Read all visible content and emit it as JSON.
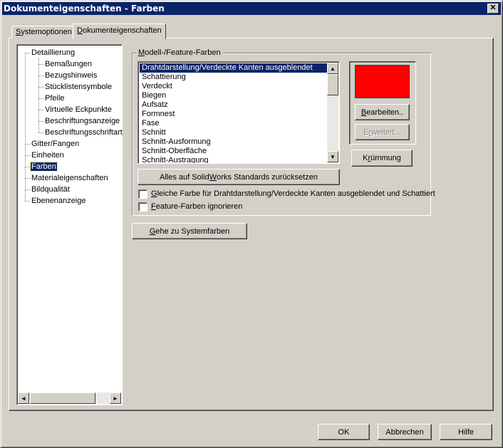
{
  "window": {
    "title": "Dokumenteigenschaften - Farben",
    "close": "✕"
  },
  "tabs": [
    {
      "pre": "",
      "key": "S",
      "post": "ystemoptionen"
    },
    {
      "pre": "",
      "key": "D",
      "post": "okumenteigenschaften"
    }
  ],
  "tree": {
    "items": [
      "Detaillierung",
      "Bemaßungen",
      "Bezugshinweis",
      "Stücklistensymbole",
      "Pfeile",
      "Virtuelle Eckpunkte",
      "Beschriftungsanzeige",
      "Beschriftungsschriftart",
      "Gitter/Fangen",
      "Einheiten",
      "Farben",
      "Materialeigenschaften",
      "Bildqualität",
      "Ebenenanzeige"
    ],
    "selected": "Farben",
    "scroll_left": "◄",
    "scroll_right": "►"
  },
  "group": {
    "label": {
      "pre": "",
      "key": "M",
      "post": "odell-/Feature-Farben"
    },
    "list": [
      "Drahtdarstellung/Verdeckte Kanten ausgeblendet",
      "Schattierung",
      "Verdeckt",
      "Biegen",
      "Aufsatz",
      "Formnest",
      "Fase",
      "Schnitt",
      "Schnitt-Ausformung",
      "Schnitt-Oberfläche",
      "Schnitt-Austragung"
    ],
    "scroll_up": "▲",
    "scroll_down": "▼",
    "swatch_color": "#ff0000",
    "edit": {
      "pre": "",
      "key": "B",
      "post": "earbeiten.."
    },
    "advanced": {
      "pre": "E",
      "key": "r",
      "post": "weitert..."
    },
    "curvature": {
      "pre": "K",
      "key": "r",
      "post": "ümmung"
    },
    "reset": {
      "pre": "Alles auf Solid",
      "key": "W",
      "post": "orks Standards zurücksetzen"
    },
    "check1": {
      "pre": "",
      "key": "G",
      "post": "leiche Farbe für Drahtdarstellung/Verdeckte Kanten ausgeblendet und Schattiert"
    },
    "check2": {
      "pre": "",
      "key": "F",
      "post": "eature-Farben ignorieren"
    }
  },
  "system_colors": {
    "pre": "",
    "key": "G",
    "post": "ehe zu Systemfarben"
  },
  "footer": {
    "ok": "OK",
    "cancel": "Abbrechen",
    "help": "Hilfe"
  }
}
